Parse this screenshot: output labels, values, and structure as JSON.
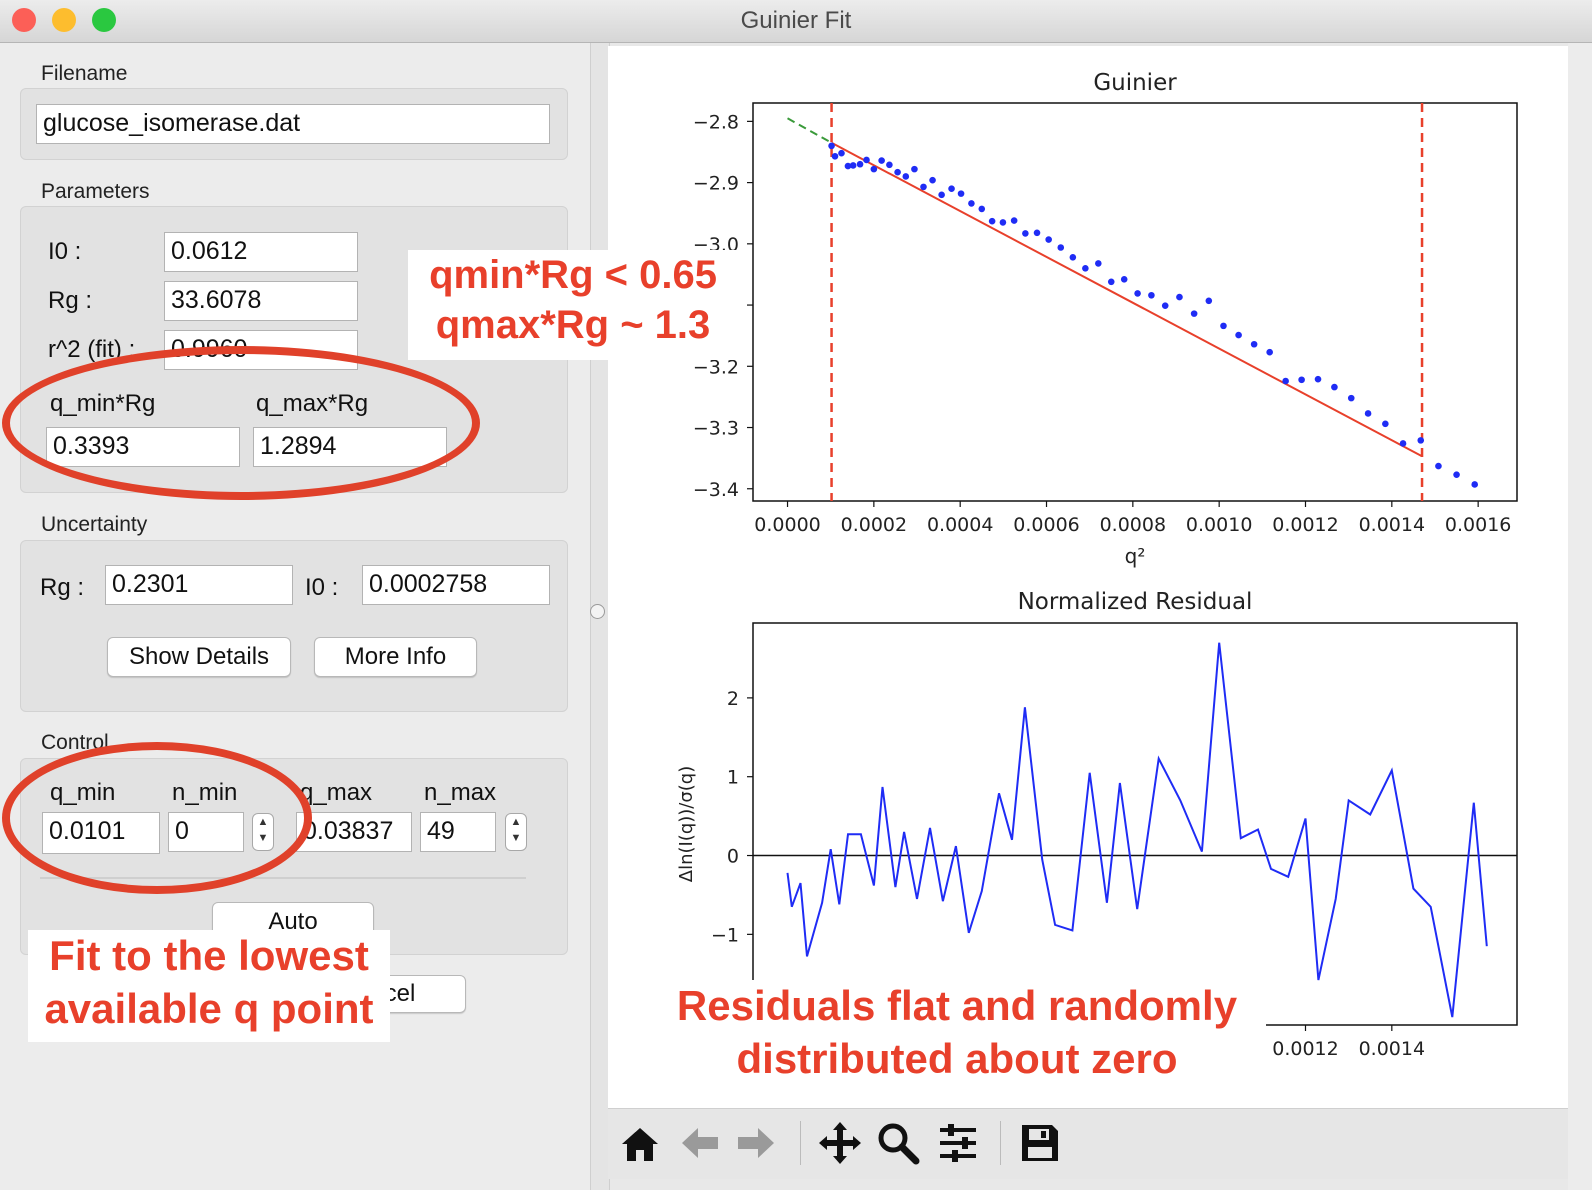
{
  "window": {
    "title": "Guinier Fit"
  },
  "filename_box": {
    "title": "Filename",
    "value": "glucose_isomerase.dat"
  },
  "parameters": {
    "title": "Parameters",
    "i0_label": "I0 :",
    "i0_value": "0.0612",
    "rg_label": "Rg :",
    "rg_value": "33.6078",
    "r2_label": "r^2 (fit) :",
    "r2_value": "0.9960",
    "qmin_rg_label": "q_min*Rg",
    "qmin_rg_value": "0.3393",
    "qmax_rg_label": "q_max*Rg",
    "qmax_rg_value": "1.2894"
  },
  "uncertainty": {
    "title": "Uncertainty",
    "rg_label": "Rg :",
    "rg_value": "0.2301",
    "i0_label": "I0 :",
    "i0_value": "0.0002758",
    "show_details": "Show Details",
    "more_info": "More Info"
  },
  "control": {
    "title": "Control",
    "qmin_label": "q_min",
    "qmin_value": "0.0101",
    "nmin_label": "n_min",
    "nmin_value": "0",
    "qmax_label": "q_max",
    "qmax_value": "0.03837",
    "nmax_label": "n_max",
    "nmax_value": "49",
    "auto": "Auto",
    "cancel": "Cancel"
  },
  "annotations": {
    "limits_1": "qmin*Rg < 0.65",
    "limits_2": "qmax*Rg ~ 1.3",
    "fit_1": "Fit to the lowest",
    "fit_2": "available q point",
    "resid_1": "Residuals flat and randomly",
    "resid_2": "distributed about zero",
    "color": "#e8402b"
  },
  "chart_data": [
    {
      "type": "scatter",
      "title": "Guinier",
      "xlabel": "q²",
      "ylabel": "",
      "xlim": [
        -8e-05,
        0.00169
      ],
      "ylim": [
        -3.42,
        -2.77
      ],
      "xticks": [
        "0.0000",
        "0.0002",
        "0.0004",
        "0.0006",
        "0.0008",
        "0.0010",
        "0.0012",
        "0.0014",
        "0.0016"
      ],
      "yticks": [
        "−2.8",
        "−2.9",
        "−3.0",
        "−3.1",
        "−3.2",
        "−3.3",
        "−3.4"
      ],
      "vlines": [
        0.000102,
        0.00147
      ],
      "fit_line": {
        "x": [
          0.000102,
          0.00147
        ],
        "y": [
          -2.835,
          -3.347
        ],
        "color": "#e8402b"
      },
      "extrapolation": {
        "x": [
          0.0,
          0.000102
        ],
        "y": [
          -2.795,
          -2.835
        ],
        "color": "#3a9a3a"
      },
      "series": [
        {
          "color": "#1f2cf5",
          "x": [
            0.000102,
            0.00011,
            0.000125,
            0.00014,
            0.000152,
            0.000168,
            0.000183,
            0.0002,
            0.000218,
            0.000236,
            0.000255,
            0.000274,
            0.000294,
            0.000315,
            0.000336,
            0.000357,
            0.00038,
            0.000402,
            0.000426,
            0.00045,
            0.000474,
            0.000499,
            0.000525,
            0.000551,
            0.000578,
            0.000605,
            0.000633,
            0.000661,
            0.00069,
            0.00072,
            0.00075,
            0.00078,
            0.000811,
            0.000843,
            0.000875,
            0.000908,
            0.000942,
            0.000976,
            0.00101,
            0.001045,
            0.001081,
            0.001117,
            0.001154,
            0.001191,
            0.001229,
            0.001267,
            0.001306,
            0.001345,
            0.001385,
            0.001426,
            0.001467,
            0.001508,
            0.00155,
            0.001592
          ],
          "y": [
            -2.84,
            -2.857,
            -2.852,
            -2.873,
            -2.872,
            -2.87,
            -2.863,
            -2.878,
            -2.864,
            -2.871,
            -2.883,
            -2.89,
            -2.878,
            -2.907,
            -2.896,
            -2.92,
            -2.91,
            -2.918,
            -2.934,
            -2.943,
            -2.963,
            -2.965,
            -2.962,
            -2.983,
            -2.982,
            -2.993,
            -3.006,
            -3.022,
            -3.04,
            -3.032,
            -3.062,
            -3.058,
            -3.081,
            -3.084,
            -3.101,
            -3.087,
            -3.114,
            -3.093,
            -3.134,
            -3.149,
            -3.164,
            -3.177,
            -3.224,
            -3.222,
            -3.221,
            -3.234,
            -3.252,
            -3.277,
            -3.294,
            -3.326,
            -3.321,
            -3.363,
            -3.377,
            -3.393
          ]
        }
      ]
    },
    {
      "type": "line",
      "title": "Normalized Residual",
      "xlabel": "",
      "ylabel": "Δln(I(q))/σ(q)",
      "xlim": [
        -8e-05,
        0.00169
      ],
      "ylim": [
        -2.15,
        2.95
      ],
      "xticks": [
        "0",
        "0.0012",
        "0.0014"
      ],
      "yticks": [
        "2",
        "1",
        "0",
        "−1"
      ],
      "hline": 0,
      "series": [
        {
          "color": "#1f2cf5",
          "x": [
            0.0,
            1e-05,
            3e-05,
            4.5e-05,
            8e-05,
            0.0001,
            0.00012,
            0.00014,
            0.00017,
            0.0002,
            0.00022,
            0.00025,
            0.00027,
            0.0003,
            0.00033,
            0.00036,
            0.00039,
            0.00042,
            0.00045,
            0.00049,
            0.00052,
            0.00055,
            0.00059,
            0.00062,
            0.00066,
            0.0007,
            0.00074,
            0.00077,
            0.00081,
            0.00086,
            0.00091,
            0.00096,
            0.001,
            0.00105,
            0.00109,
            0.00112,
            0.00116,
            0.0012,
            0.00123,
            0.00127,
            0.0013,
            0.00135,
            0.0014,
            0.00145,
            0.00149,
            0.00154,
            0.00159,
            0.00162
          ],
          "y": [
            -0.22,
            -0.65,
            -0.35,
            -1.28,
            -0.6,
            0.08,
            -0.62,
            0.27,
            0.27,
            -0.38,
            0.87,
            -0.4,
            0.3,
            -0.55,
            0.35,
            -0.58,
            0.12,
            -0.98,
            -0.45,
            0.79,
            0.2,
            1.88,
            -0.05,
            -0.88,
            -0.95,
            1.05,
            -0.6,
            0.92,
            -0.68,
            1.23,
            0.7,
            0.05,
            2.7,
            0.22,
            0.33,
            -0.17,
            -0.27,
            0.47,
            -1.58,
            -0.55,
            0.7,
            0.52,
            1.08,
            -0.42,
            -0.65,
            -2.05,
            0.67,
            -1.15
          ]
        }
      ]
    }
  ]
}
